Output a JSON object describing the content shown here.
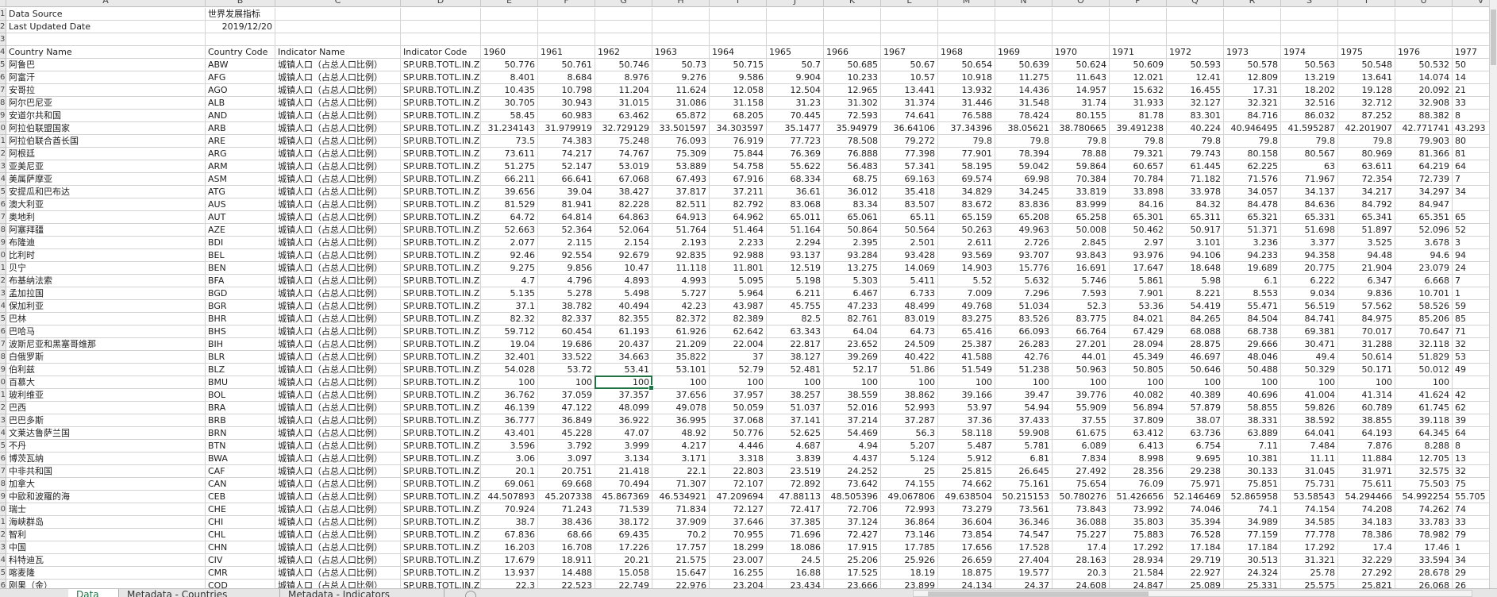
{
  "column_letters": [
    "A",
    "B",
    "C",
    "D",
    "E",
    "F",
    "G",
    "H",
    "I",
    "J",
    "K",
    "L",
    "M",
    "N",
    "O",
    "P",
    "Q",
    "R",
    "S",
    "T",
    "U",
    "V"
  ],
  "first_row_number": 1,
  "meta": {
    "data_source_label": "Data Source",
    "data_source_value": "世界发展指标",
    "last_updated_label": "Last Updated Date",
    "last_updated_value": "2019/12/20"
  },
  "headers": {
    "country_name": "Country Name",
    "country_code": "Country Code",
    "indicator_name": "Indicator Name",
    "indicator_code": "Indicator Code",
    "years": [
      "1960",
      "1961",
      "1962",
      "1963",
      "1964",
      "1965",
      "1966",
      "1967",
      "1968",
      "1969",
      "1970",
      "1971",
      "1972",
      "1973",
      "1974",
      "1975",
      "1976",
      "1977"
    ]
  },
  "indicator_name": "城镇人口（占总人口比例）",
  "indicator_code": "SP.URB.TOTL.IN.ZS",
  "selected_cell": {
    "row_index": 25,
    "year": "1962"
  },
  "rows": [
    {
      "name": "阿鲁巴",
      "code": "ABW",
      "values": [
        "50.776",
        "50.761",
        "50.746",
        "50.73",
        "50.715",
        "50.7",
        "50.685",
        "50.67",
        "50.654",
        "50.639",
        "50.624",
        "50.609",
        "50.593",
        "50.578",
        "50.563",
        "50.548",
        "50.532",
        "50"
      ]
    },
    {
      "name": "阿富汗",
      "code": "AFG",
      "values": [
        "8.401",
        "8.684",
        "8.976",
        "9.276",
        "9.586",
        "9.904",
        "10.233",
        "10.57",
        "10.918",
        "11.275",
        "11.643",
        "12.021",
        "12.41",
        "12.809",
        "13.219",
        "13.641",
        "14.074",
        "14"
      ]
    },
    {
      "name": "安哥拉",
      "code": "AGO",
      "values": [
        "10.435",
        "10.798",
        "11.204",
        "11.624",
        "12.058",
        "12.504",
        "12.965",
        "13.441",
        "13.932",
        "14.436",
        "14.957",
        "15.632",
        "16.455",
        "17.31",
        "18.202",
        "19.128",
        "20.092",
        "21"
      ]
    },
    {
      "name": "阿尔巴尼亚",
      "code": "ALB",
      "values": [
        "30.705",
        "30.943",
        "31.015",
        "31.086",
        "31.158",
        "31.23",
        "31.302",
        "31.374",
        "31.446",
        "31.548",
        "31.74",
        "31.933",
        "32.127",
        "32.321",
        "32.516",
        "32.712",
        "32.908",
        "33"
      ]
    },
    {
      "name": "安道尔共和国",
      "code": "AND",
      "values": [
        "58.45",
        "60.983",
        "63.462",
        "65.872",
        "68.205",
        "70.445",
        "72.593",
        "74.641",
        "76.588",
        "78.424",
        "80.155",
        "81.78",
        "83.301",
        "84.716",
        "86.032",
        "87.252",
        "88.382",
        "8"
      ]
    },
    {
      "name": "阿拉伯联盟国家",
      "code": "ARB",
      "values": [
        "31.234143",
        "31.979919",
        "32.729129",
        "33.501597",
        "34.303597",
        "35.1477",
        "35.94979",
        "36.64106",
        "37.34396",
        "38.05621",
        "38.780665",
        "39.491238",
        "40.224",
        "40.946495",
        "41.595287",
        "42.201907",
        "42.771741",
        "43.293"
      ]
    },
    {
      "name": "阿拉伯联合酋长国",
      "code": "ARE",
      "values": [
        "73.5",
        "74.383",
        "75.248",
        "76.093",
        "76.919",
        "77.723",
        "78.508",
        "79.272",
        "79.8",
        "79.8",
        "79.8",
        "79.8",
        "79.8",
        "79.8",
        "79.8",
        "79.8",
        "79.903",
        "80"
      ]
    },
    {
      "name": "阿根廷",
      "code": "ARG",
      "values": [
        "73.611",
        "74.217",
        "74.767",
        "75.309",
        "75.844",
        "76.369",
        "76.888",
        "77.398",
        "77.901",
        "78.394",
        "78.88",
        "79.321",
        "79.743",
        "80.158",
        "80.567",
        "80.969",
        "81.366",
        "81"
      ]
    },
    {
      "name": "亚美尼亚",
      "code": "ARM",
      "values": [
        "51.275",
        "52.147",
        "53.019",
        "53.889",
        "54.758",
        "55.622",
        "56.483",
        "57.341",
        "58.195",
        "59.042",
        "59.864",
        "60.657",
        "61.445",
        "62.225",
        "63",
        "63.611",
        "64.219",
        "64"
      ]
    },
    {
      "name": "美属萨摩亚",
      "code": "ASM",
      "values": [
        "66.211",
        "66.641",
        "67.068",
        "67.493",
        "67.916",
        "68.334",
        "68.75",
        "69.163",
        "69.574",
        "69.98",
        "70.384",
        "70.784",
        "71.182",
        "71.576",
        "71.967",
        "72.354",
        "72.739",
        "7"
      ]
    },
    {
      "name": "安提瓜和巴布达",
      "code": "ATG",
      "values": [
        "39.656",
        "39.04",
        "38.427",
        "37.817",
        "37.211",
        "36.61",
        "36.012",
        "35.418",
        "34.829",
        "34.245",
        "33.819",
        "33.898",
        "33.978",
        "34.057",
        "34.137",
        "34.217",
        "34.297",
        "34"
      ]
    },
    {
      "name": "澳大利亚",
      "code": "AUS",
      "values": [
        "81.529",
        "81.941",
        "82.228",
        "82.511",
        "82.792",
        "83.068",
        "83.34",
        "83.507",
        "83.672",
        "83.836",
        "83.999",
        "84.16",
        "84.32",
        "84.478",
        "84.636",
        "84.792",
        "84.947",
        ""
      ]
    },
    {
      "name": "奥地利",
      "code": "AUT",
      "values": [
        "64.72",
        "64.814",
        "64.863",
        "64.913",
        "64.962",
        "65.011",
        "65.061",
        "65.11",
        "65.159",
        "65.208",
        "65.258",
        "65.301",
        "65.311",
        "65.321",
        "65.331",
        "65.341",
        "65.351",
        "65"
      ]
    },
    {
      "name": "阿塞拜疆",
      "code": "AZE",
      "values": [
        "52.663",
        "52.364",
        "52.064",
        "51.764",
        "51.464",
        "51.164",
        "50.864",
        "50.564",
        "50.263",
        "49.963",
        "50.008",
        "50.462",
        "50.917",
        "51.371",
        "51.698",
        "51.897",
        "52.096",
        "52"
      ]
    },
    {
      "name": "布隆迪",
      "code": "BDI",
      "values": [
        "2.077",
        "2.115",
        "2.154",
        "2.193",
        "2.233",
        "2.294",
        "2.395",
        "2.501",
        "2.611",
        "2.726",
        "2.845",
        "2.97",
        "3.101",
        "3.236",
        "3.377",
        "3.525",
        "3.678",
        "3"
      ]
    },
    {
      "name": "比利时",
      "code": "BEL",
      "values": [
        "92.46",
        "92.554",
        "92.679",
        "92.835",
        "92.988",
        "93.137",
        "93.284",
        "93.428",
        "93.569",
        "93.707",
        "93.843",
        "93.976",
        "94.106",
        "94.233",
        "94.358",
        "94.48",
        "94.6",
        "94"
      ]
    },
    {
      "name": "贝宁",
      "code": "BEN",
      "values": [
        "9.275",
        "9.856",
        "10.47",
        "11.118",
        "11.801",
        "12.519",
        "13.275",
        "14.069",
        "14.903",
        "15.776",
        "16.691",
        "17.647",
        "18.648",
        "19.689",
        "20.775",
        "21.904",
        "23.079",
        "24"
      ]
    },
    {
      "name": "布基纳法索",
      "code": "BFA",
      "values": [
        "4.7",
        "4.796",
        "4.893",
        "4.993",
        "5.095",
        "5.198",
        "5.303",
        "5.411",
        "5.52",
        "5.632",
        "5.746",
        "5.861",
        "5.98",
        "6.1",
        "6.222",
        "6.347",
        "6.668",
        "7"
      ]
    },
    {
      "name": "孟加拉国",
      "code": "BGD",
      "values": [
        "5.135",
        "5.278",
        "5.498",
        "5.727",
        "5.964",
        "6.211",
        "6.467",
        "6.733",
        "7.009",
        "7.296",
        "7.593",
        "7.901",
        "8.221",
        "8.553",
        "9.034",
        "9.836",
        "10.701",
        "1"
      ]
    },
    {
      "name": "保加利亚",
      "code": "BGR",
      "values": [
        "37.1",
        "38.782",
        "40.494",
        "42.23",
        "43.987",
        "45.755",
        "47.233",
        "48.499",
        "49.768",
        "51.034",
        "52.3",
        "53.36",
        "54.419",
        "55.471",
        "56.519",
        "57.562",
        "58.526",
        "59"
      ]
    },
    {
      "name": "巴林",
      "code": "BHR",
      "values": [
        "82.32",
        "82.337",
        "82.355",
        "82.372",
        "82.389",
        "82.5",
        "82.761",
        "83.019",
        "83.275",
        "83.526",
        "83.775",
        "84.021",
        "84.265",
        "84.504",
        "84.741",
        "84.975",
        "85.206",
        "85"
      ]
    },
    {
      "name": "巴哈马",
      "code": "BHS",
      "values": [
        "59.712",
        "60.454",
        "61.193",
        "61.926",
        "62.642",
        "63.343",
        "64.04",
        "64.73",
        "65.416",
        "66.093",
        "66.764",
        "67.429",
        "68.088",
        "68.738",
        "69.381",
        "70.017",
        "70.647",
        "71"
      ]
    },
    {
      "name": "波斯尼亚和黑塞哥维那",
      "code": "BIH",
      "values": [
        "19.04",
        "19.686",
        "20.437",
        "21.209",
        "22.004",
        "22.817",
        "23.652",
        "24.509",
        "25.387",
        "26.283",
        "27.201",
        "28.094",
        "28.875",
        "29.666",
        "30.471",
        "31.288",
        "32.118",
        "32"
      ]
    },
    {
      "name": "白俄罗斯",
      "code": "BLR",
      "values": [
        "32.401",
        "33.522",
        "34.663",
        "35.822",
        "37",
        "38.127",
        "39.269",
        "40.422",
        "41.588",
        "42.76",
        "44.01",
        "45.349",
        "46.697",
        "48.046",
        "49.4",
        "50.614",
        "51.829",
        "53"
      ]
    },
    {
      "name": "伯利兹",
      "code": "BLZ",
      "values": [
        "54.028",
        "53.72",
        "53.41",
        "53.101",
        "52.79",
        "52.481",
        "52.17",
        "51.86",
        "51.549",
        "51.238",
        "50.963",
        "50.805",
        "50.646",
        "50.488",
        "50.329",
        "50.171",
        "50.012",
        "49"
      ]
    },
    {
      "name": "百慕大",
      "code": "BMU",
      "values": [
        "100",
        "100",
        "100",
        "100",
        "100",
        "100",
        "100",
        "100",
        "100",
        "100",
        "100",
        "100",
        "100",
        "100",
        "100",
        "100",
        "100",
        ""
      ]
    },
    {
      "name": "玻利维亚",
      "code": "BOL",
      "values": [
        "36.762",
        "37.059",
        "37.357",
        "37.656",
        "37.957",
        "38.257",
        "38.559",
        "38.862",
        "39.166",
        "39.47",
        "39.776",
        "40.082",
        "40.389",
        "40.696",
        "41.004",
        "41.314",
        "41.624",
        "42"
      ]
    },
    {
      "name": "巴西",
      "code": "BRA",
      "values": [
        "46.139",
        "47.122",
        "48.099",
        "49.078",
        "50.059",
        "51.037",
        "52.016",
        "52.993",
        "53.97",
        "54.94",
        "55.909",
        "56.894",
        "57.879",
        "58.855",
        "59.826",
        "60.789",
        "61.745",
        "62"
      ]
    },
    {
      "name": "巴巴多斯",
      "code": "BRB",
      "values": [
        "36.777",
        "36.849",
        "36.922",
        "36.995",
        "37.068",
        "37.141",
        "37.214",
        "37.287",
        "37.36",
        "37.433",
        "37.55",
        "37.809",
        "38.07",
        "38.331",
        "38.592",
        "38.855",
        "39.118",
        "39"
      ]
    },
    {
      "name": "文莱达鲁萨兰国",
      "code": "BRN",
      "values": [
        "43.401",
        "45.228",
        "47.07",
        "48.92",
        "50.776",
        "52.625",
        "54.469",
        "56.3",
        "58.118",
        "59.908",
        "61.675",
        "63.412",
        "63.736",
        "63.889",
        "64.041",
        "64.193",
        "64.345",
        "64"
      ]
    },
    {
      "name": "不丹",
      "code": "BTN",
      "values": [
        "3.596",
        "3.792",
        "3.999",
        "4.217",
        "4.446",
        "4.687",
        "4.94",
        "5.207",
        "5.487",
        "5.781",
        "6.089",
        "6.413",
        "6.754",
        "7.11",
        "7.484",
        "7.876",
        "8.288",
        "8"
      ]
    },
    {
      "name": "博茨瓦纳",
      "code": "BWA",
      "values": [
        "3.06",
        "3.097",
        "3.134",
        "3.171",
        "3.318",
        "3.839",
        "4.437",
        "5.124",
        "5.912",
        "6.81",
        "7.834",
        "8.998",
        "9.695",
        "10.381",
        "11.11",
        "11.884",
        "12.705",
        "13"
      ]
    },
    {
      "name": "中非共和国",
      "code": "CAF",
      "values": [
        "20.1",
        "20.751",
        "21.418",
        "22.1",
        "22.803",
        "23.519",
        "24.252",
        "25",
        "25.815",
        "26.645",
        "27.492",
        "28.356",
        "29.238",
        "30.133",
        "31.045",
        "31.971",
        "32.575",
        "32"
      ]
    },
    {
      "name": "加拿大",
      "code": "CAN",
      "values": [
        "69.061",
        "69.668",
        "70.494",
        "71.307",
        "72.107",
        "72.892",
        "73.642",
        "74.155",
        "74.662",
        "75.161",
        "75.654",
        "76.09",
        "75.971",
        "75.851",
        "75.731",
        "75.611",
        "75.503",
        "75"
      ]
    },
    {
      "name": "中歐和波羅的海",
      "code": "CEB",
      "values": [
        "44.507893",
        "45.207338",
        "45.867369",
        "46.534921",
        "47.209694",
        "47.88113",
        "48.505396",
        "49.067806",
        "49.638504",
        "50.215153",
        "50.780276",
        "51.426656",
        "52.146469",
        "52.865958",
        "53.58543",
        "54.294466",
        "54.992254",
        "55.705"
      ]
    },
    {
      "name": "瑞士",
      "code": "CHE",
      "values": [
        "70.924",
        "71.243",
        "71.539",
        "71.834",
        "72.127",
        "72.417",
        "72.706",
        "72.993",
        "73.279",
        "73.561",
        "73.843",
        "73.992",
        "74.046",
        "74.1",
        "74.154",
        "74.208",
        "74.262",
        "74"
      ]
    },
    {
      "name": "海峡群岛",
      "code": "CHI",
      "values": [
        "38.7",
        "38.436",
        "38.172",
        "37.909",
        "37.646",
        "37.385",
        "37.124",
        "36.864",
        "36.604",
        "36.346",
        "36.088",
        "35.803",
        "35.394",
        "34.989",
        "34.585",
        "34.183",
        "33.783",
        "33"
      ]
    },
    {
      "name": "智利",
      "code": "CHL",
      "values": [
        "67.836",
        "68.66",
        "69.435",
        "70.2",
        "70.955",
        "71.696",
        "72.427",
        "73.146",
        "73.854",
        "74.547",
        "75.227",
        "75.883",
        "76.528",
        "77.159",
        "77.778",
        "78.386",
        "78.982",
        "79"
      ]
    },
    {
      "name": "中国",
      "code": "CHN",
      "values": [
        "16.203",
        "16.708",
        "17.226",
        "17.757",
        "18.299",
        "18.086",
        "17.915",
        "17.785",
        "17.656",
        "17.528",
        "17.4",
        "17.292",
        "17.184",
        "17.184",
        "17.292",
        "17.4",
        "17.46",
        "1"
      ]
    },
    {
      "name": "科特迪瓦",
      "code": "CIV",
      "values": [
        "17.679",
        "18.911",
        "20.21",
        "21.575",
        "23.007",
        "24.5",
        "25.206",
        "25.926",
        "26.659",
        "27.404",
        "28.163",
        "28.934",
        "29.719",
        "30.513",
        "31.321",
        "32.229",
        "33.594",
        "34"
      ]
    },
    {
      "name": "喀麦隆",
      "code": "CMR",
      "values": [
        "13.937",
        "14.488",
        "15.058",
        "15.647",
        "16.255",
        "16.88",
        "17.525",
        "18.19",
        "18.875",
        "19.577",
        "20.3",
        "21.584",
        "22.927",
        "24.324",
        "25.78",
        "27.292",
        "28.678",
        "29"
      ]
    },
    {
      "name": "刚果（金）",
      "code": "COD",
      "values": [
        "22.3",
        "22.523",
        "22.749",
        "22.976",
        "23.204",
        "23.434",
        "23.666",
        "23.899",
        "24.134",
        "24.37",
        "24.608",
        "24.847",
        "25.089",
        "25.331",
        "25.575",
        "25.821",
        "26.068",
        "26"
      ]
    }
  ],
  "sheet_tabs": [
    {
      "label": "Data",
      "active": true
    },
    {
      "label": "Metadata - Countries",
      "active": false
    },
    {
      "label": "Metadata - Indicators",
      "active": false
    }
  ],
  "colors": {
    "accent": "#217346",
    "grid": "#d4d4d4",
    "header_bg": "#e9e9e9"
  }
}
